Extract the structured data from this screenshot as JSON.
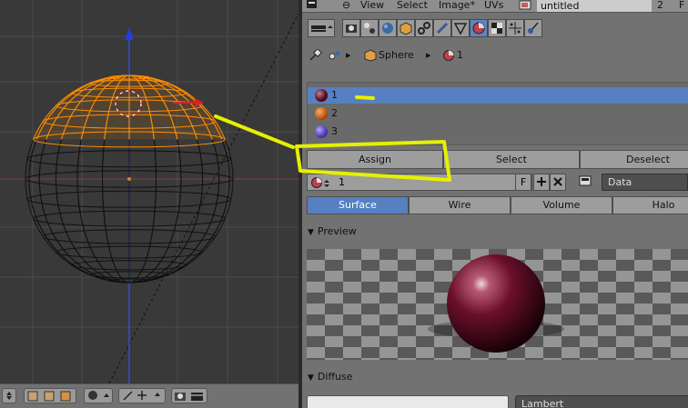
{
  "topbar": {
    "menu": [
      "View",
      "Select",
      "Image*",
      "UVs"
    ],
    "image_name": "untitled",
    "user_count": "2",
    "fake_user": "F"
  },
  "breadcrumb": {
    "object": "Sphere",
    "material": "1"
  },
  "material_slots": [
    {
      "label": "1",
      "color": "#5a0a1e",
      "selected": true
    },
    {
      "label": "2",
      "color": "#c85a10",
      "selected": false
    },
    {
      "label": "3",
      "color": "#5040c0",
      "selected": false
    }
  ],
  "slot_buttons": {
    "assign": "Assign",
    "select": "Select",
    "deselect": "Deselect"
  },
  "material_field": {
    "name": "1",
    "fake_user": "F",
    "link": "Data"
  },
  "material_tabs": [
    "Surface",
    "Wire",
    "Volume",
    "Halo"
  ],
  "panels": {
    "preview": "Preview",
    "diffuse": "Diffuse"
  },
  "diffuse": {
    "shader": "Lambert",
    "color": "#e9e9e9"
  },
  "colors": {
    "selection": "#5680c2",
    "mesh_selected": "#ff8c00",
    "annotation": "#e6f000",
    "preview_sphere": "#6b0f2c"
  },
  "icons": {
    "pin": "pin-icon",
    "object": "cube-icon",
    "material": "material-icon",
    "add": "plus-icon",
    "remove": "x-icon"
  }
}
